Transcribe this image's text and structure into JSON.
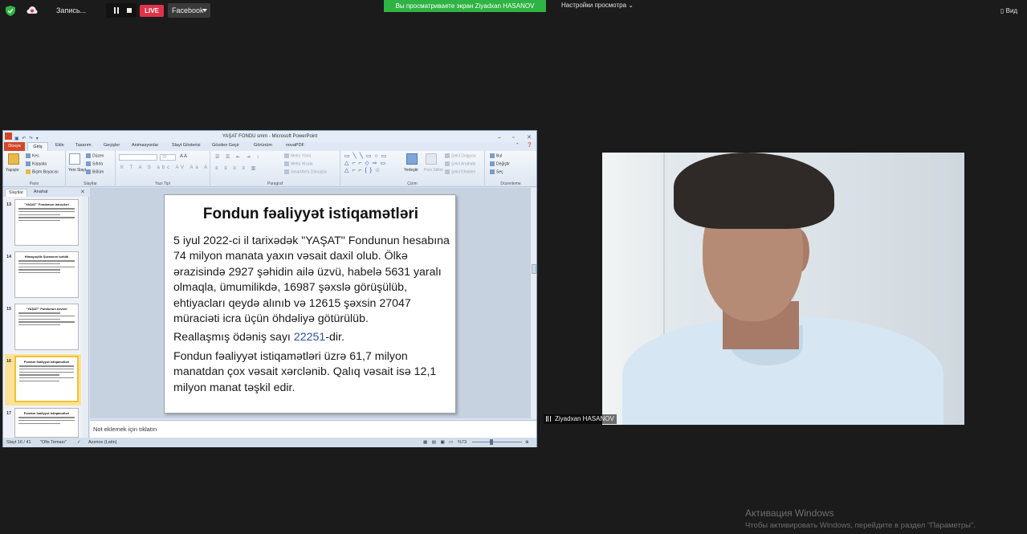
{
  "topbar": {
    "recording_label": "Запись...",
    "live_label": "LIVE",
    "stream_target": "Facebook",
    "share_banner": "Вы просматриваете экран Ziyadxan HASANOV",
    "view_settings": "Настройки просмотра",
    "view_label": "Вид"
  },
  "ppt": {
    "window_title": "YAŞAT FONDU smm - Microsoft PowerPoint",
    "tabs": [
      "Dosya",
      "Giriş",
      "Ekle",
      "Tasarım",
      "Geçişler",
      "Animasyonlar",
      "Slayt Gösterisi",
      "Gözden Geçir",
      "Görünüm",
      "novaPDF"
    ],
    "ribbon": {
      "pano": {
        "label": "Pano",
        "paste": "Yapıştır",
        "cut": "Kes",
        "copy": "Kopyala",
        "format_painter": "Biçim Boyacısı"
      },
      "slaytlar": {
        "label": "Slaytlar",
        "new_slide": "Yeni Slayt",
        "layout": "Düzen",
        "reset": "Sıfırla",
        "section": "Bölüm"
      },
      "yazi_tipi": {
        "label": "Yazı Tipi",
        "size": "32"
      },
      "paragraf": {
        "label": "Paragraf",
        "text_direction": "Metin Yönü",
        "align_text": "Metni Hizala",
        "smartart": "SmartArt'a Dönüştür"
      },
      "cizim": {
        "label": "Çizim",
        "arrange": "Yerleştir",
        "quick_styles": "Hızlı Stiller",
        "shape_fill": "Şekil Dolgusu",
        "shape_outline": "Şekil Anahattı",
        "shape_effects": "Şekil Efektleri"
      },
      "duzenleme": {
        "label": "Düzenleme",
        "find": "Bul",
        "replace": "Değiştir",
        "select": "Seç"
      }
    },
    "pane": {
      "tab_slides": "Slaytlar",
      "tab_outline": "Anahat",
      "thumbs": [
        {
          "num": "13",
          "title": "\"YAŞAT\" Fondunun ianəçiləri",
          "selected": false
        },
        {
          "num": "14",
          "title": "Himayəçilik Şurasının tərkibi",
          "selected": false
        },
        {
          "num": "15",
          "title": "\"YAŞAT\" Fondunun üzvləri",
          "selected": false
        },
        {
          "num": "16",
          "title": "Fondun fəaliyyət istiqamətləri",
          "selected": true
        },
        {
          "num": "17",
          "title": "Fondun fəaliyyət istiqamətləri",
          "selected": false
        }
      ]
    },
    "slide": {
      "title": "Fondun fəaliyyət istiqamətləri",
      "p1": "5 iyul 2022-ci il tarixədək \"YAŞAT\" Fondunun hesabına 74 milyon manata yaxın vəsait daxil olub. Ölkə ərazisində 2927 şəhidin ailə üzvü, habelə 5631 yaralı olmaqla, ümumilikdə, 16987 şəxslə görüşülüb, ehtiyacları qeydə alınıb və 12615 şəxsin 27047 müraciəti icra üçün öhdəliyə götürülüb.",
      "p2_pre": "Reallaşmış ödəniş sayı ",
      "p2_num": "22251",
      "p2_post": "-dir.",
      "p3": "Fondun fəaliyyət istiqamətləri üzrə 61,7 milyon manatdan çox vəsait xərclənib. Qalıq vəsait isə 12,1 milyon manat təşkil edir."
    },
    "notes_placeholder": "Not eklemek için tıklatın",
    "status": {
      "slide_counter": "Slayt 16 / 41",
      "theme": "\"Ofis Teması\"",
      "language": "Azərice (Latin)",
      "zoom": "%73"
    }
  },
  "video": {
    "participant_name": "Ziyadxan HASANOV"
  },
  "watermark": {
    "line1": "Активация Windows",
    "line2": "Чтобы активировать Windows, перейдите в раздел \"Параметры\"."
  }
}
